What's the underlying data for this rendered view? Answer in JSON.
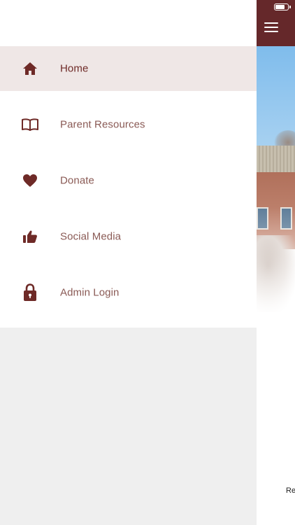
{
  "drawer": {
    "items": [
      {
        "label": "Home",
        "icon": "home-icon",
        "active": true
      },
      {
        "label": "Parent Resources",
        "icon": "book-icon",
        "active": false
      },
      {
        "label": "Donate",
        "icon": "heart-icon",
        "active": false
      },
      {
        "label": "Social Media",
        "icon": "thumbs-up-icon",
        "active": false
      },
      {
        "label": "Admin Login",
        "icon": "lock-icon",
        "active": false
      }
    ]
  },
  "main": {
    "menu_icon": "hamburger-menu-icon",
    "bottom_text": "Re"
  },
  "status_bar": {
    "battery_level": 0.75
  },
  "colors": {
    "brand": "#65282a",
    "icon": "#6e2a27",
    "label": "#8a5a55",
    "active_bg": "#efe7e6",
    "drawer_bg": "#efefef"
  }
}
